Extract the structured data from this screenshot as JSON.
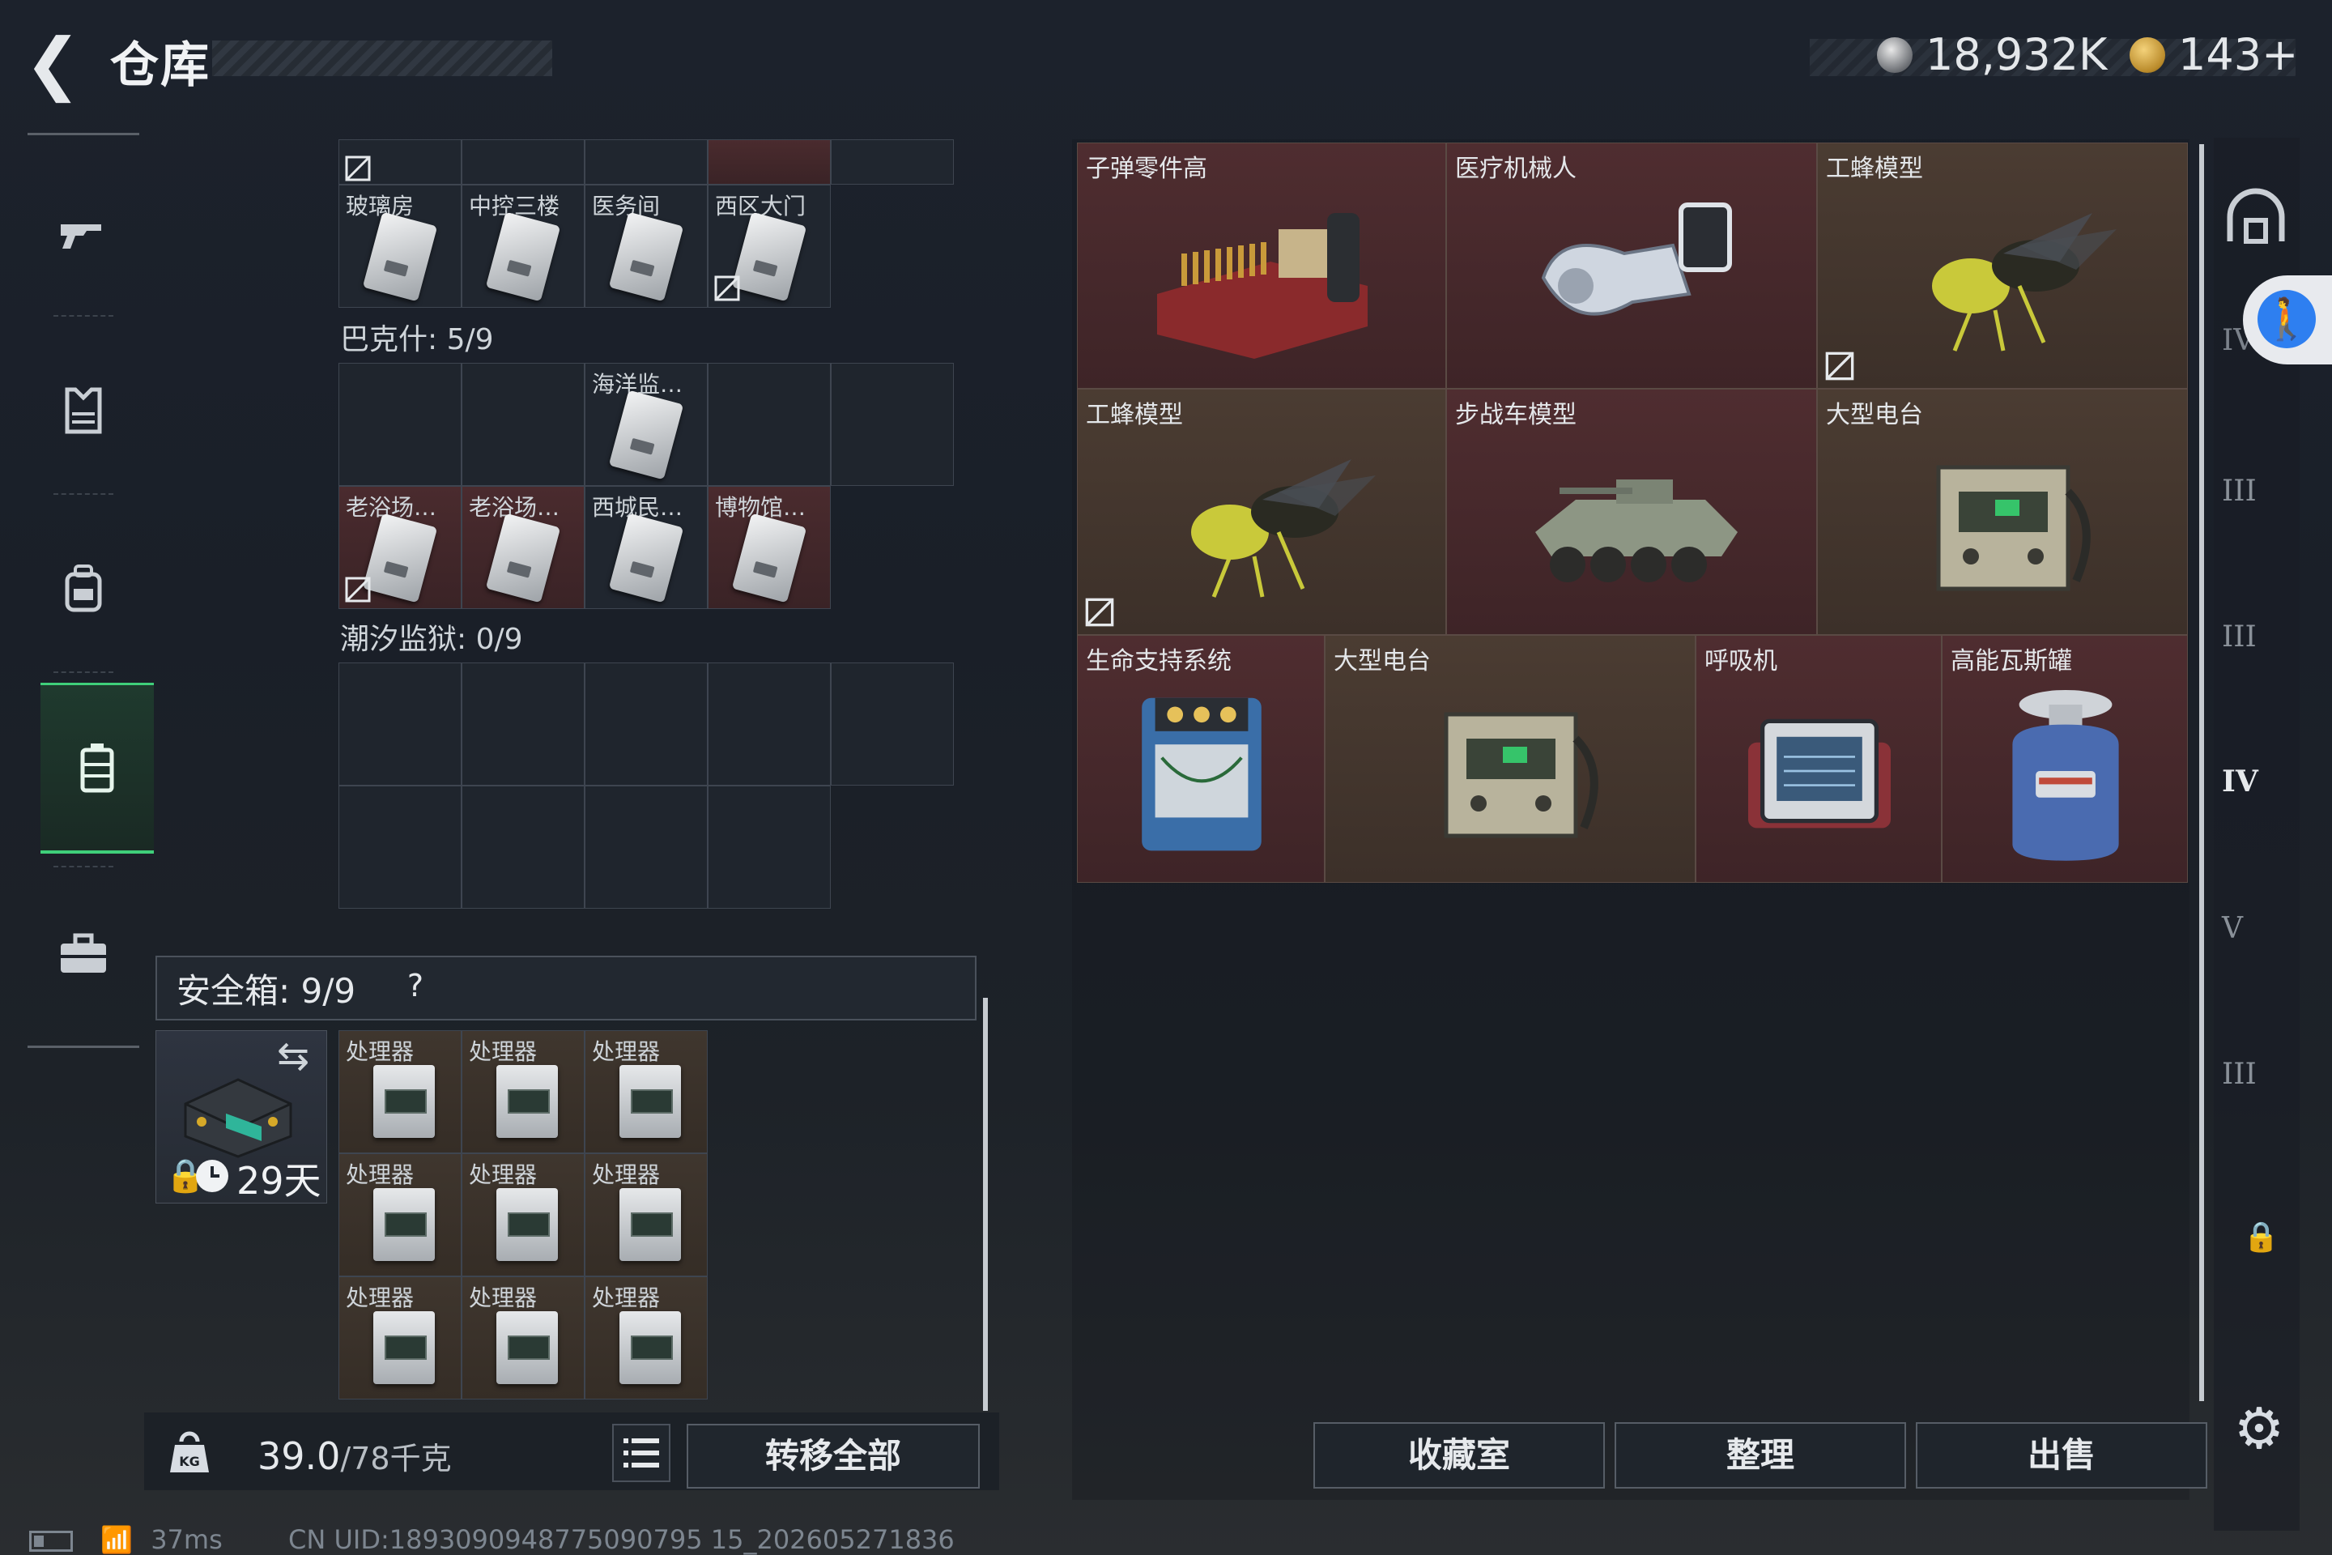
{
  "header": {
    "title": "仓库",
    "currency1": "18,932K",
    "currency2": "143+"
  },
  "nav": [
    "gun-icon",
    "armor-icon",
    "backpack-icon",
    "rig-icon",
    "case-icon"
  ],
  "stash": {
    "top_row_labels": [
      "玻璃房",
      "中控三楼",
      "医务间",
      "西区大门"
    ],
    "section1": {
      "label": "巴克什: 5/9",
      "row1": [
        "海洋监…"
      ],
      "row2": [
        "老浴场…",
        "老浴场…",
        "西城民…",
        "博物馆…"
      ]
    },
    "section2": {
      "label": "潮汐监狱: 0/9"
    },
    "safe": {
      "label": "安全箱: 9/9",
      "help": "?",
      "days": "29天",
      "items": [
        "处理器",
        "处理器",
        "处理器",
        "处理器",
        "处理器",
        "处理器",
        "处理器",
        "处理器",
        "处理器"
      ]
    },
    "weight": {
      "current": "39.0",
      "max": "/78千克"
    },
    "transfer_all": "转移全部"
  },
  "status": {
    "ping": "37ms",
    "uid": "CN UID:1893090948775090795 15_202605271836"
  },
  "inventory": [
    {
      "label": "子弹零件高",
      "art": "ammo-crate"
    },
    {
      "label": "医疗机械人",
      "art": "robot-arm"
    },
    {
      "label": "工蜂模型",
      "art": "wasp"
    },
    {
      "label": "工蜂模型",
      "art": "wasp"
    },
    {
      "label": "步战车模型",
      "art": "ifv"
    },
    {
      "label": "大型电台",
      "art": "radio"
    },
    {
      "label": "生命支持系统",
      "art": "life-support"
    },
    {
      "label": "大型电台",
      "art": "radio"
    },
    {
      "label": "呼吸机",
      "art": "ventilator"
    },
    {
      "label": "高能瓦斯罐",
      "art": "gas-tank"
    }
  ],
  "buttons": {
    "collection": "收藏室",
    "organize": "整理",
    "sell": "出售"
  },
  "right_nav": [
    "dome-icon",
    "IV",
    "III",
    "III",
    "IV",
    "V",
    "III"
  ]
}
